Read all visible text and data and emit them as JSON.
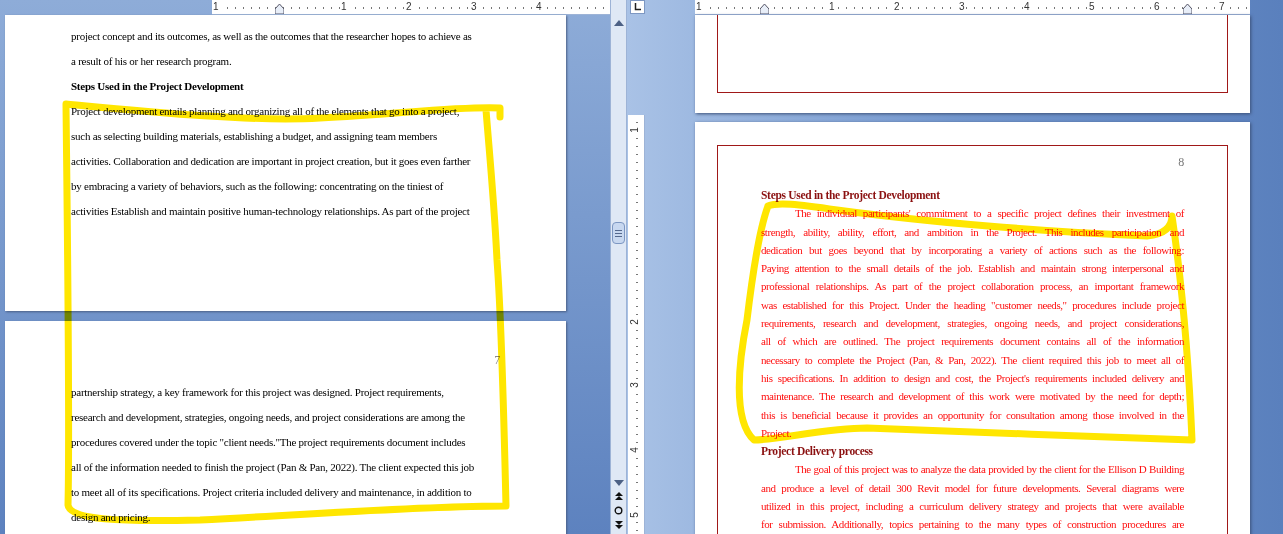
{
  "left_pane": {
    "ruler": {
      "labels": [
        "1",
        "1",
        "2",
        "3",
        "4"
      ]
    },
    "pages": [
      {
        "lines": [
          {
            "kind": "body",
            "text": "project concept and its outcomes, as well as the outcomes that the researcher hopes to achieve as"
          },
          {
            "kind": "body",
            "text": "a result of his or her research program."
          },
          {
            "kind": "heading",
            "text": "Steps Used in the Project Development"
          },
          {
            "kind": "body",
            "text": "Project development entails planning and organizing all of the elements that go into a project,"
          },
          {
            "kind": "body",
            "text": "such as selecting building materials, establishing a budget, and assigning team members"
          },
          {
            "kind": "body",
            "text": "activities. Collaboration and dedication are important in project creation, but it goes even farther"
          },
          {
            "kind": "body",
            "text": "by embracing a variety of behaviors, such as the following: concentrating on the tiniest of"
          },
          {
            "kind": "body",
            "text": "activities Establish and maintain positive human-technology relationships. As part of the project"
          }
        ]
      },
      {
        "page_number": "7",
        "lines": [
          {
            "kind": "body",
            "text": "partnership strategy, a key framework for this project was designed. Project requirements,"
          },
          {
            "kind": "body",
            "text": "research and development, strategies, ongoing needs, and project considerations are among the"
          },
          {
            "kind": "body",
            "text": "procedures covered under the topic \"client needs.\"The project requirements document includes"
          },
          {
            "kind": "body",
            "text": "all of the information needed to finish the project (Pan & Pan, 2022). The client expected this job"
          },
          {
            "kind": "body",
            "text": "to meet all of its specifications. Project criteria included delivery and maintenance, in addition to"
          },
          {
            "kind": "body",
            "text": "design and pricing."
          }
        ]
      }
    ]
  },
  "right_pane": {
    "ruler": {
      "labels": [
        "1",
        "1",
        "2",
        "3",
        "4",
        "5",
        "6",
        "7"
      ]
    },
    "vertical_ruler": {
      "labels": [
        "1",
        "2",
        "3",
        "4",
        "5"
      ]
    },
    "pages": [
      {
        "kind": "blank"
      },
      {
        "kind": "text",
        "page_number": "8",
        "blocks": [
          {
            "kind": "heading",
            "text": "Steps Used in the Project Development"
          },
          {
            "kind": "paragraph",
            "lines": [
              "The individual participants' commitment to a specific project defines their investment of",
              "strength, ability, ability, effort, and ambition in the Project. This includes participation and",
              "dedication but goes beyond that by incorporating a variety of actions such as the following:",
              "Paying attention to the small details of the job. Establish and maintain strong interpersonal and",
              "professional relationships. As part of the project collaboration process, an important framework",
              "was established for this Project. Under the heading \"customer needs,\" procedures include project",
              "requirements, research and development, strategies, ongoing needs, and project considerations,",
              "all of which are outlined. The project requirements document contains all of the information",
              "necessary to complete the Project (Pan, & Pan, 2022). The client required this job to meet all of",
              "his specifications. In addition to design and cost, the Project's requirements included delivery and",
              "maintenance. The research and development of this work were motivated by the need for depth;",
              "this is beneficial because it provides an opportunity for consultation among those involved in the",
              "Project."
            ]
          },
          {
            "kind": "heading",
            "text": "Project Delivery process"
          },
          {
            "kind": "paragraph",
            "lines": [
              "The goal of this project was to analyze the data provided by the client for the Ellison D Building",
              "and produce a level of detail 300 Revit model for future developments. Several diagrams were",
              "utilized in this project, including a curriculum delivery strategy and projects that were available",
              "for submission. Additionally, topics pertaining to the many types of construction procedures are"
            ]
          }
        ]
      }
    ]
  }
}
